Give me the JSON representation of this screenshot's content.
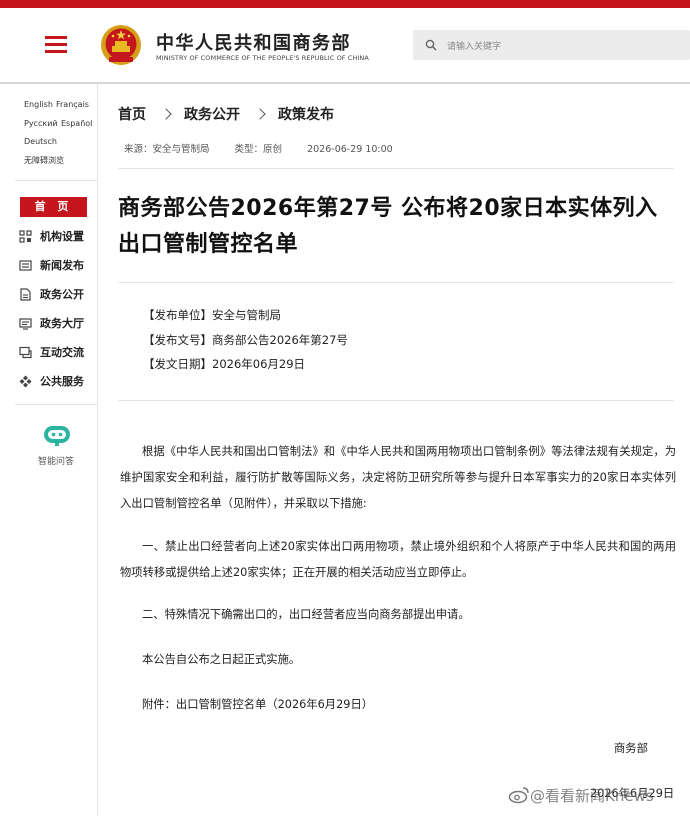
{
  "header": {
    "org_name_cn": "中华人民共和国商务部",
    "org_name_en": "MINISTRY OF COMMERCE OF THE PEOPLE'S REPUBLIC OF CHINA",
    "search_placeholder": "请输入关键字",
    "brand_color": "#c4161c"
  },
  "sidebar": {
    "languages": [
      "English",
      "Français",
      "Русский",
      "Español",
      "Deutsch",
      "无障碍浏览"
    ],
    "home_label": "首 页",
    "items": [
      {
        "label": "机构设置",
        "icon": "org-chart-icon"
      },
      {
        "label": "新闻发布",
        "icon": "news-icon"
      },
      {
        "label": "政务公开",
        "icon": "document-icon"
      },
      {
        "label": "政务大厅",
        "icon": "hall-icon"
      },
      {
        "label": "互动交流",
        "icon": "chat-icon"
      },
      {
        "label": "公共服务",
        "icon": "service-icon"
      }
    ],
    "assistant_label": "智能问答"
  },
  "breadcrumb": [
    "首页",
    "政务公开",
    "政策发布"
  ],
  "meta": {
    "source": "来源：安全与管制局",
    "type": "类型：原创",
    "datetime": "2026-06-29 10:00"
  },
  "article": {
    "title": "商务部公告2026年第27号 公布将20家日本实体列入出口管制管控名单",
    "info": [
      "【发布单位】安全与管制局",
      "【发布文号】商务部公告2026年第27号",
      "【发文日期】2026年06月29日"
    ],
    "paragraph_1": "根据《中华人民共和国出口管制法》和《中华人民共和国两用物项出口管制条例》等法律法规有关规定，为维护国家安全和利益，履行防扩散等国际义务，决定将防卫研究所等参与提升日本军事实力的20家日本实体列入出口管制管控名单（见附件），并采取以下措施:",
    "paragraph_2": "一、禁止出口经营者向上述20家实体出口两用物项，禁止境外组织和个人将原产于中华人民共和国的两用物项转移或提供给上述20家实体；正在开展的相关活动应当立即停止。",
    "paragraph_3": "二、特殊情况下确需出口的，出口经营者应当向商务部提出申请。",
    "paragraph_4": "本公告自公布之日起正式实施。",
    "attachment": "附件：出口管制管控名单（2026年6月29日）",
    "signature": "商务部",
    "sign_date": "2026年6月29日"
  },
  "watermark": "@看看新闻Knews"
}
